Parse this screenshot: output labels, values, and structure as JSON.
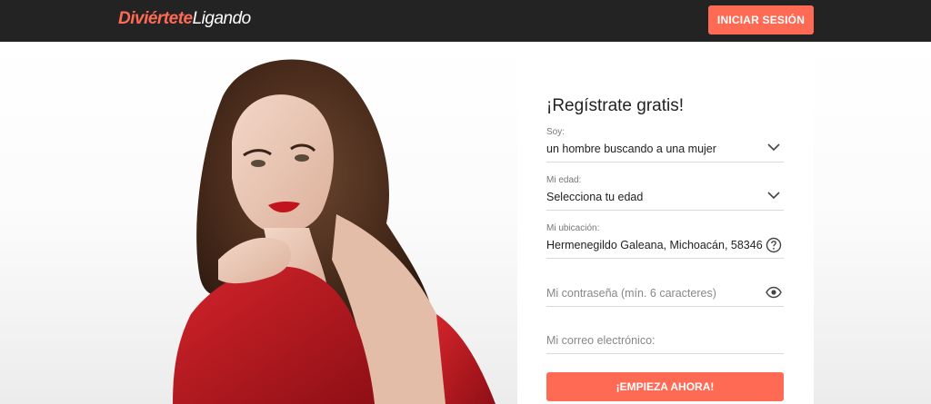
{
  "header": {
    "logo_part1": "Diviértete",
    "logo_part2": "Ligando",
    "login_label": "INICIAR SESIÓN"
  },
  "form": {
    "title": "¡Regístrate gratis!",
    "soy": {
      "label": "Soy:",
      "value": "un hombre buscando a una mujer",
      "icon": "chevron-down-icon"
    },
    "edad": {
      "label": "Mi edad:",
      "value": "Selecciona tu edad",
      "icon": "chevron-down-icon"
    },
    "ubicacion": {
      "label": "Mi ubicación:",
      "value": "Hermenegildo Galeana, Michoacán, 58346",
      "icon": "help-circle-icon"
    },
    "password": {
      "placeholder": "Mi contraseña (mín. 6 caracteres)",
      "icon": "eye-icon"
    },
    "email": {
      "placeholder": "Mi correo electrónico:"
    },
    "submit_label": "¡EMPIEZA AHORA!"
  },
  "colors": {
    "accent": "#ff6a55",
    "topbar": "#232323",
    "dress": "#c2141d"
  }
}
